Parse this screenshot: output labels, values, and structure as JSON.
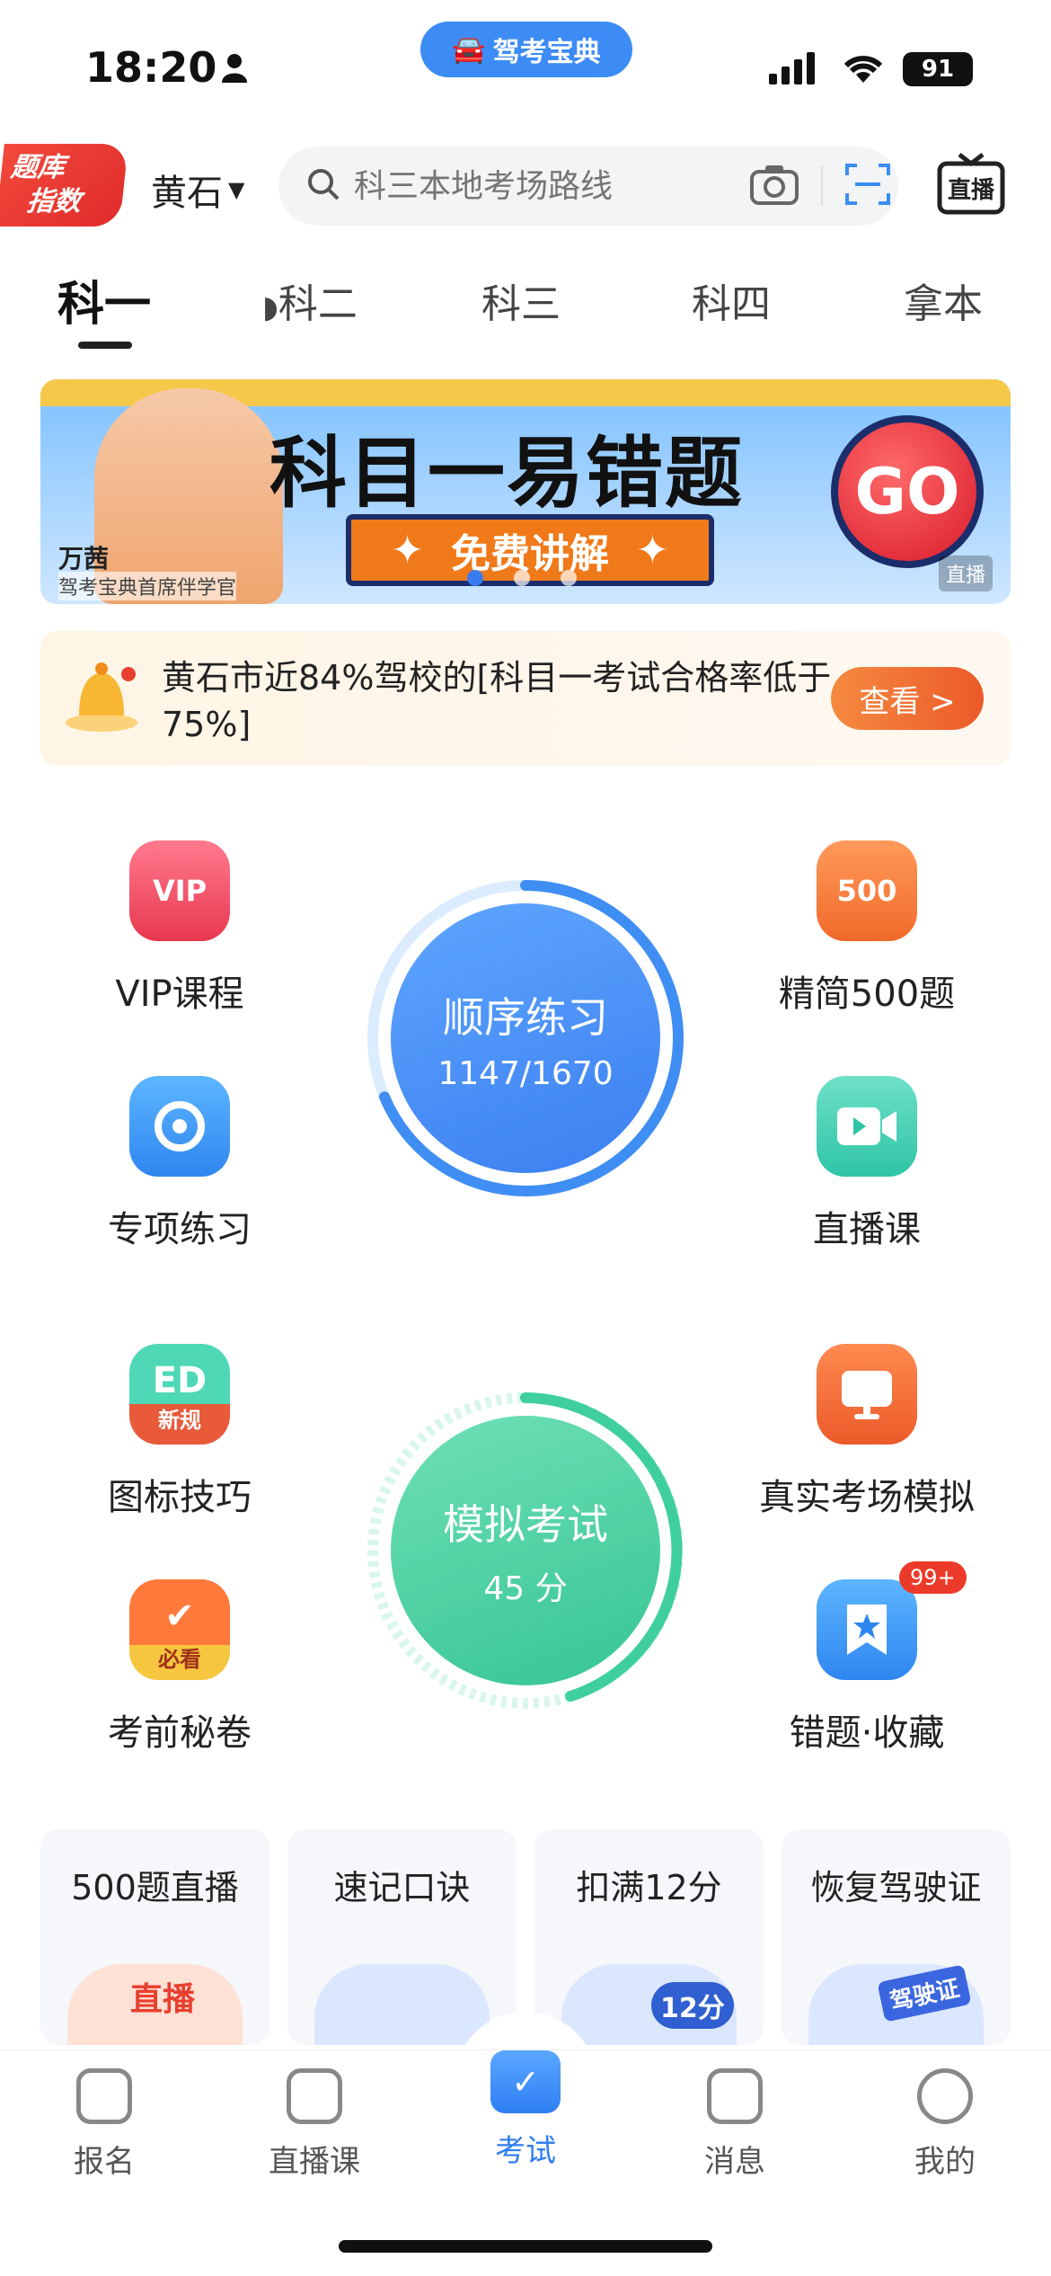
{
  "status": {
    "time": "18:20",
    "app_badge": "驾考宝典",
    "battery": "91"
  },
  "header": {
    "tiku_line1": "题库",
    "tiku_line2": "指数",
    "city": "黄石",
    "search_placeholder": "科三本地考场路线"
  },
  "tabs": [
    "科一",
    "科二",
    "科三",
    "科四",
    "拿本"
  ],
  "banner": {
    "title": "科目一易错题",
    "subtitle": "免费讲解",
    "go": "GO",
    "name": "万茜",
    "role": "驾考宝典首席伴学官",
    "tag": "直播"
  },
  "notice": {
    "text": "黄石市近84%驾校的[科目一考试合格率低于75%]",
    "button": "查看 >"
  },
  "features": {
    "vip": "VIP课程",
    "jingjian500": "精简500题",
    "zhuanxiang": "专项练习",
    "zhiboke": "直播课",
    "tubiao": "图标技巧",
    "tubiao_badge": "新规",
    "zhenshi": "真实考场模拟",
    "kaoqian": "考前秘卷",
    "kaoqian_badge": "必看",
    "cuoti": "错题·收藏",
    "cuoti_badge": "99+"
  },
  "practice": {
    "title": "顺序练习",
    "progress": "1147/1670",
    "progress_fraction": 0.687
  },
  "exam": {
    "title": "模拟考试",
    "score": "45 分"
  },
  "cards": [
    {
      "label": "500题直播",
      "art": "直播"
    },
    {
      "label": "速记口诀",
      "art": ""
    },
    {
      "label": "扣满12分",
      "art": "12分"
    },
    {
      "label": "恢复驾驶证",
      "art": "驾驶证"
    }
  ],
  "nav": [
    "报名",
    "直播课",
    "考试",
    "消息",
    "我的"
  ],
  "colors": {
    "primary": "#2f7ef3",
    "exam_green": "#3fcf9f",
    "orange": "#ec5a2a"
  }
}
